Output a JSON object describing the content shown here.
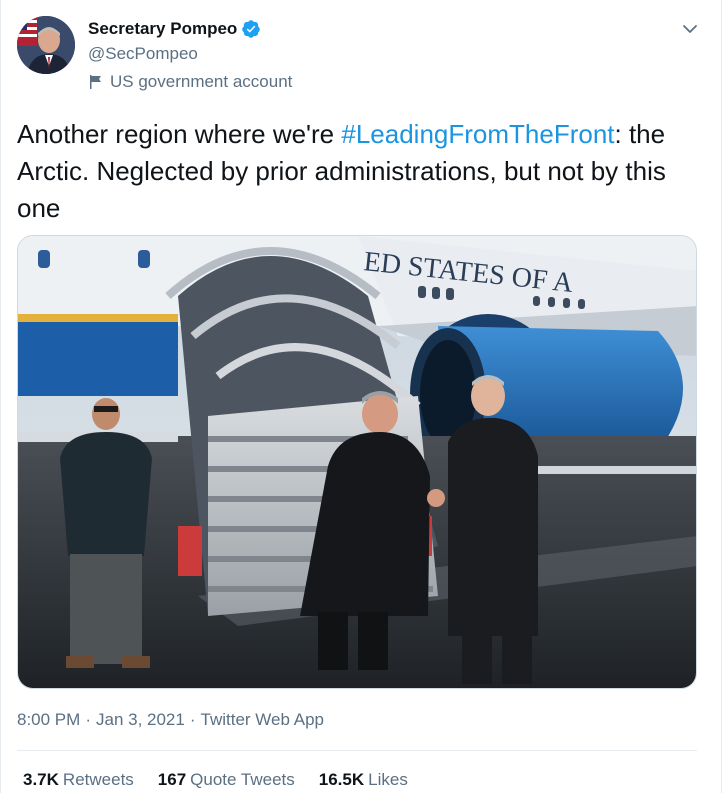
{
  "author": {
    "display_name": "Secretary Pompeo",
    "handle": "@SecPompeo",
    "label": "US government account",
    "verified": true,
    "verified_color": "#1da1f2",
    "avatar_icon": "avatar"
  },
  "tweet": {
    "text_before": "Another region where we're ",
    "hashtag": "#LeadingFromTheFront",
    "text_after": ": the Arctic. Neglected by prior administrations, but not by this one",
    "hashtag_color": "#1b95e0"
  },
  "media": {
    "aircraft_text": "ED STATES OF A"
  },
  "meta": {
    "time": "8:00 PM",
    "separator": "·",
    "date": "Jan 3, 2021",
    "source": "Twitter Web App"
  },
  "stats": {
    "retweets_count": "3.7K",
    "retweets_label": "Retweets",
    "quotes_count": "167",
    "quotes_label": "Quote Tweets",
    "likes_count": "16.5K",
    "likes_label": "Likes"
  },
  "icons": {
    "more": "chevron-down-icon",
    "verified": "verified-badge-icon",
    "government": "flag-icon"
  }
}
